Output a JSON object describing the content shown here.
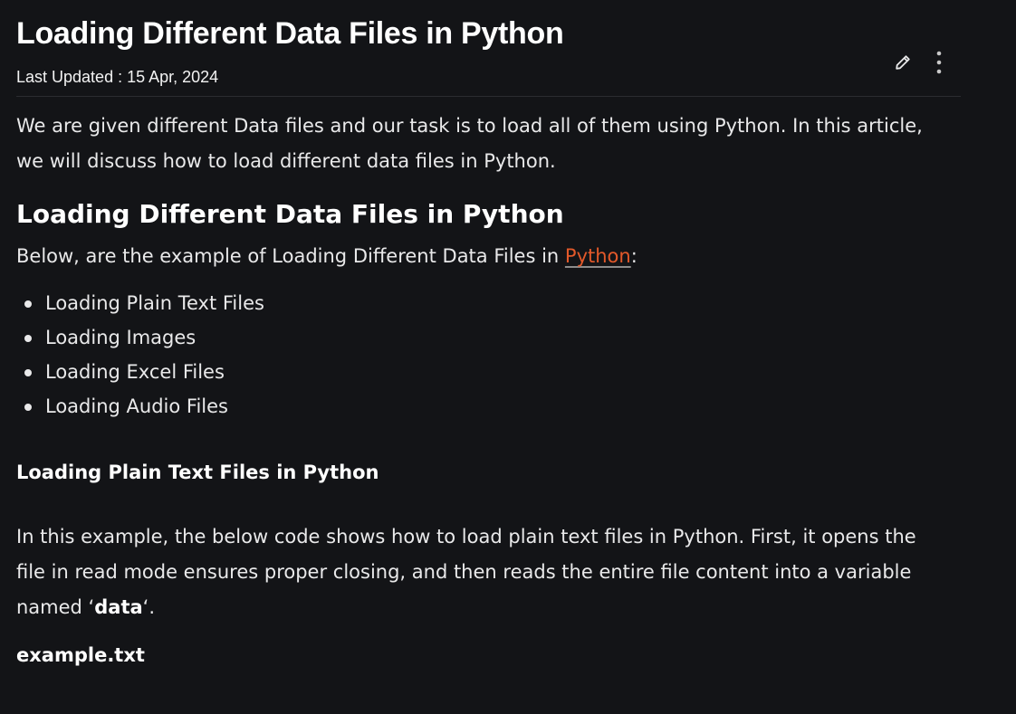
{
  "article": {
    "title": "Loading Different Data Files in Python",
    "last_updated": "Last Updated : 15 Apr, 2024",
    "intro": "We are given different Data files and our task is to load all of them using Python. In this article, we will discuss how to load different data files in Python.",
    "section_heading": "Loading Different Data Files in Python",
    "below_text_before": "Below, are the example of Loading Different Data Files in ",
    "below_link": "Python",
    "below_text_after": ":",
    "toc": [
      "Loading Plain Text Files",
      "Loading Images",
      "Loading Excel Files",
      "Loading Audio Files"
    ],
    "subsection_heading": "Loading Plain Text Files in Python",
    "para_before": "In this example, the below code shows how to load plain text files in Python. First, it opens the file in read mode ensures proper closing, and then reads the entire file content into a variable named ‘",
    "para_bold": "data",
    "para_after": "‘.",
    "file_label": "example.txt"
  },
  "actions": {
    "edit_icon": "pencil-icon",
    "more_icon": "more-vertical-icon"
  },
  "colors": {
    "background": "#131417",
    "text": "#e9e9ea",
    "link": "#e3592a"
  }
}
